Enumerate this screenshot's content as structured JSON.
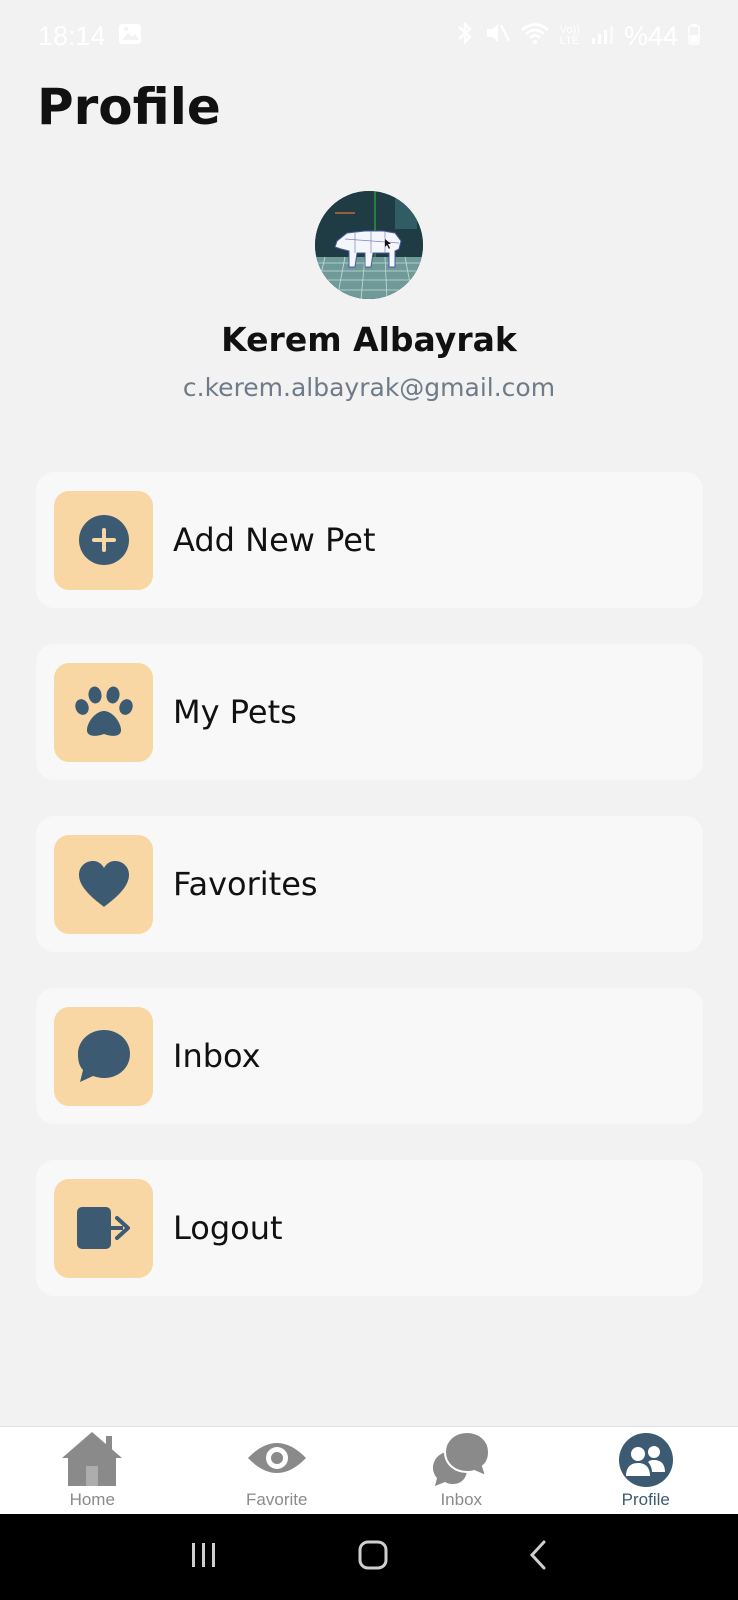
{
  "status_bar": {
    "time": "18:14",
    "battery": "%44",
    "network_label": "Vo))\nLTE"
  },
  "page": {
    "title": "Profile"
  },
  "user": {
    "name": "Kerem Albayrak",
    "email": "c.kerem.albayrak@gmail.com"
  },
  "menu": [
    {
      "label": "Add New Pet",
      "icon": "add-circle-icon"
    },
    {
      "label": "My Pets",
      "icon": "paw-icon"
    },
    {
      "label": "Favorites",
      "icon": "heart-icon"
    },
    {
      "label": "Inbox",
      "icon": "chat-bubble-icon"
    },
    {
      "label": "Logout",
      "icon": "logout-icon"
    }
  ],
  "bottom_nav": [
    {
      "label": "Home",
      "icon": "home-icon",
      "active": false
    },
    {
      "label": "Favorite",
      "icon": "eye-icon",
      "active": false
    },
    {
      "label": "Inbox",
      "icon": "chat-bubbles-icon",
      "active": false
    },
    {
      "label": "Profile",
      "icon": "profile-users-icon",
      "active": true
    }
  ],
  "colors": {
    "background": "#f2f2f2",
    "card": "#f8f8f8",
    "icon_tile": "#f8d7a4",
    "icon_fill": "#3d5a73",
    "email_text": "#6f7b88",
    "nav_inactive": "#8a8a8a"
  }
}
